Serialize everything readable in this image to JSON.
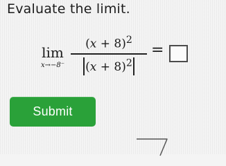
{
  "prompt": {
    "text": "Evaluate the limit."
  },
  "math": {
    "lim_label": "lim",
    "lim_subscript": "x→−8⁻",
    "numerator": {
      "open_paren": "(",
      "variable": "x",
      "operator": " + ",
      "constant": "8",
      "close_paren": ")",
      "exponent": "2"
    },
    "denominator": {
      "open_paren": "(",
      "variable": "x",
      "operator": " + ",
      "constant": "8",
      "close_paren": ")",
      "exponent": "2"
    },
    "equals": "="
  },
  "answer": {
    "value": ""
  },
  "button": {
    "label": "Submit",
    "color": "#2aa139"
  }
}
